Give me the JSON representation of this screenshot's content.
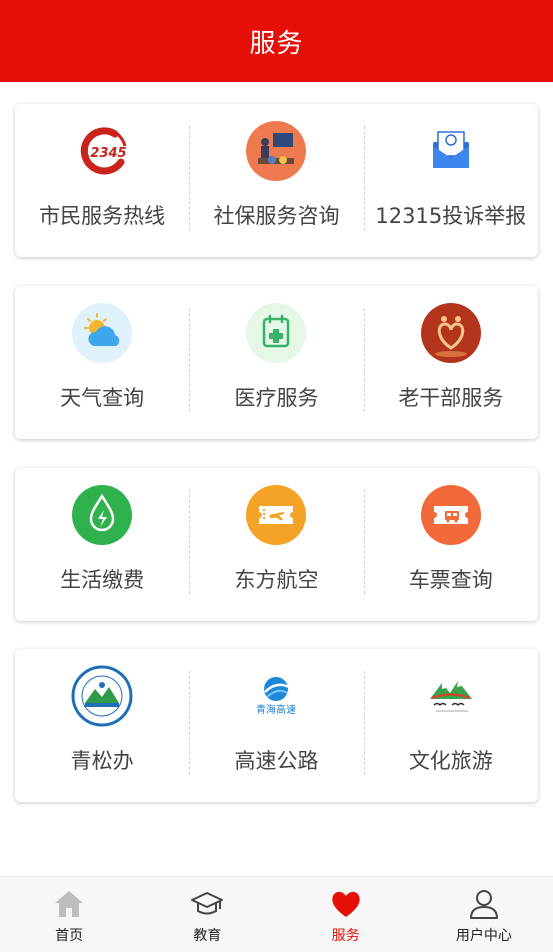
{
  "header": {
    "title": "服务"
  },
  "cards": [
    {
      "items": [
        {
          "label": "市民服务热线",
          "icon": "hotline-12345-icon"
        },
        {
          "label": "社保服务咨询",
          "icon": "social-security-consult-icon"
        },
        {
          "label": "12315投诉举报",
          "icon": "complaint-mail-icon"
        }
      ]
    },
    {
      "items": [
        {
          "label": "天气查询",
          "icon": "weather-icon"
        },
        {
          "label": "医疗服务",
          "icon": "medical-icon"
        },
        {
          "label": "老干部服务",
          "icon": "veteran-cadre-icon"
        }
      ]
    },
    {
      "items": [
        {
          "label": "生活缴费",
          "icon": "utility-payment-icon"
        },
        {
          "label": "东方航空",
          "icon": "airline-ticket-icon"
        },
        {
          "label": "车票查询",
          "icon": "bus-ticket-icon"
        }
      ]
    },
    {
      "items": [
        {
          "label": "青松办",
          "icon": "qingsong-logo-icon"
        },
        {
          "label": "高速公路",
          "icon": "qinghai-expressway-logo-icon"
        },
        {
          "label": "文化旅游",
          "icon": "culture-tourism-logo-icon"
        }
      ]
    }
  ],
  "icon_text": {
    "hotline": "12345",
    "qinghai_expressway": "青海高速"
  },
  "tabbar": {
    "items": [
      {
        "label": "首页",
        "icon": "home-icon"
      },
      {
        "label": "教育",
        "icon": "graduation-cap-icon"
      },
      {
        "label": "服务",
        "icon": "heart-icon",
        "active": true
      },
      {
        "label": "用户中心",
        "icon": "user-icon"
      }
    ]
  },
  "colors": {
    "header": "#e50f07",
    "active_tab": "#e50f07",
    "label": "#444444"
  }
}
